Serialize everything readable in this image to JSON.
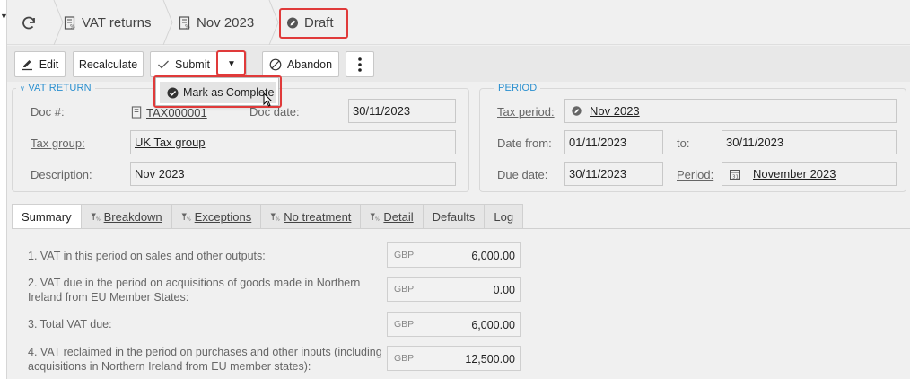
{
  "breadcrumb": {
    "items": [
      {
        "label": "VAT returns"
      },
      {
        "label": "Nov 2023"
      },
      {
        "label": "Draft"
      }
    ]
  },
  "toolbar": {
    "edit_label": "Edit",
    "recalculate_label": "Recalculate",
    "submit_label": "Submit",
    "abandon_label": "Abandon"
  },
  "menu": {
    "mark_complete_label": "Mark as Complete"
  },
  "vat_return": {
    "legend": "VAT RETURN",
    "doc_no_label": "Doc #:",
    "doc_no_value": "TAX000001",
    "doc_date_label": "Doc date:",
    "doc_date_value": "30/11/2023",
    "tax_group_label": "Tax group:",
    "tax_group_value": "UK Tax group",
    "description_label": "Description:",
    "description_value": "Nov 2023"
  },
  "period": {
    "legend": "PERIOD",
    "tax_period_label": "Tax period:",
    "tax_period_value": "Nov 2023",
    "date_from_label": "Date from:",
    "date_from_value": "01/11/2023",
    "to_label": "to:",
    "to_value": "30/11/2023",
    "due_date_label": "Due date:",
    "due_date_value": "30/11/2023",
    "period_label": "Period:",
    "period_value": "November 2023"
  },
  "tabs": [
    {
      "label": "Summary"
    },
    {
      "label": "Breakdown"
    },
    {
      "label": "Exceptions"
    },
    {
      "label": "No treatment"
    },
    {
      "label": "Detail"
    },
    {
      "label": "Defaults"
    },
    {
      "label": "Log"
    }
  ],
  "summary": {
    "rows": [
      {
        "text": "1. VAT in this period on sales and other outputs:",
        "currency": "GBP",
        "value": "6,000.00"
      },
      {
        "text": "2. VAT due in the period on acquisitions of goods made in Northern Ireland from EU Member States:",
        "currency": "GBP",
        "value": "0.00"
      },
      {
        "text": "3. Total VAT due:",
        "currency": "GBP",
        "value": "6,000.00"
      },
      {
        "text": "4. VAT reclaimed in the period on purchases and other inputs (including acquisitions in Northern Ireland from EU member states):",
        "currency": "GBP",
        "value": "12,500.00"
      }
    ]
  },
  "colors": {
    "highlight_red": "#e03a3a",
    "legend_blue": "#2a8fcf"
  }
}
